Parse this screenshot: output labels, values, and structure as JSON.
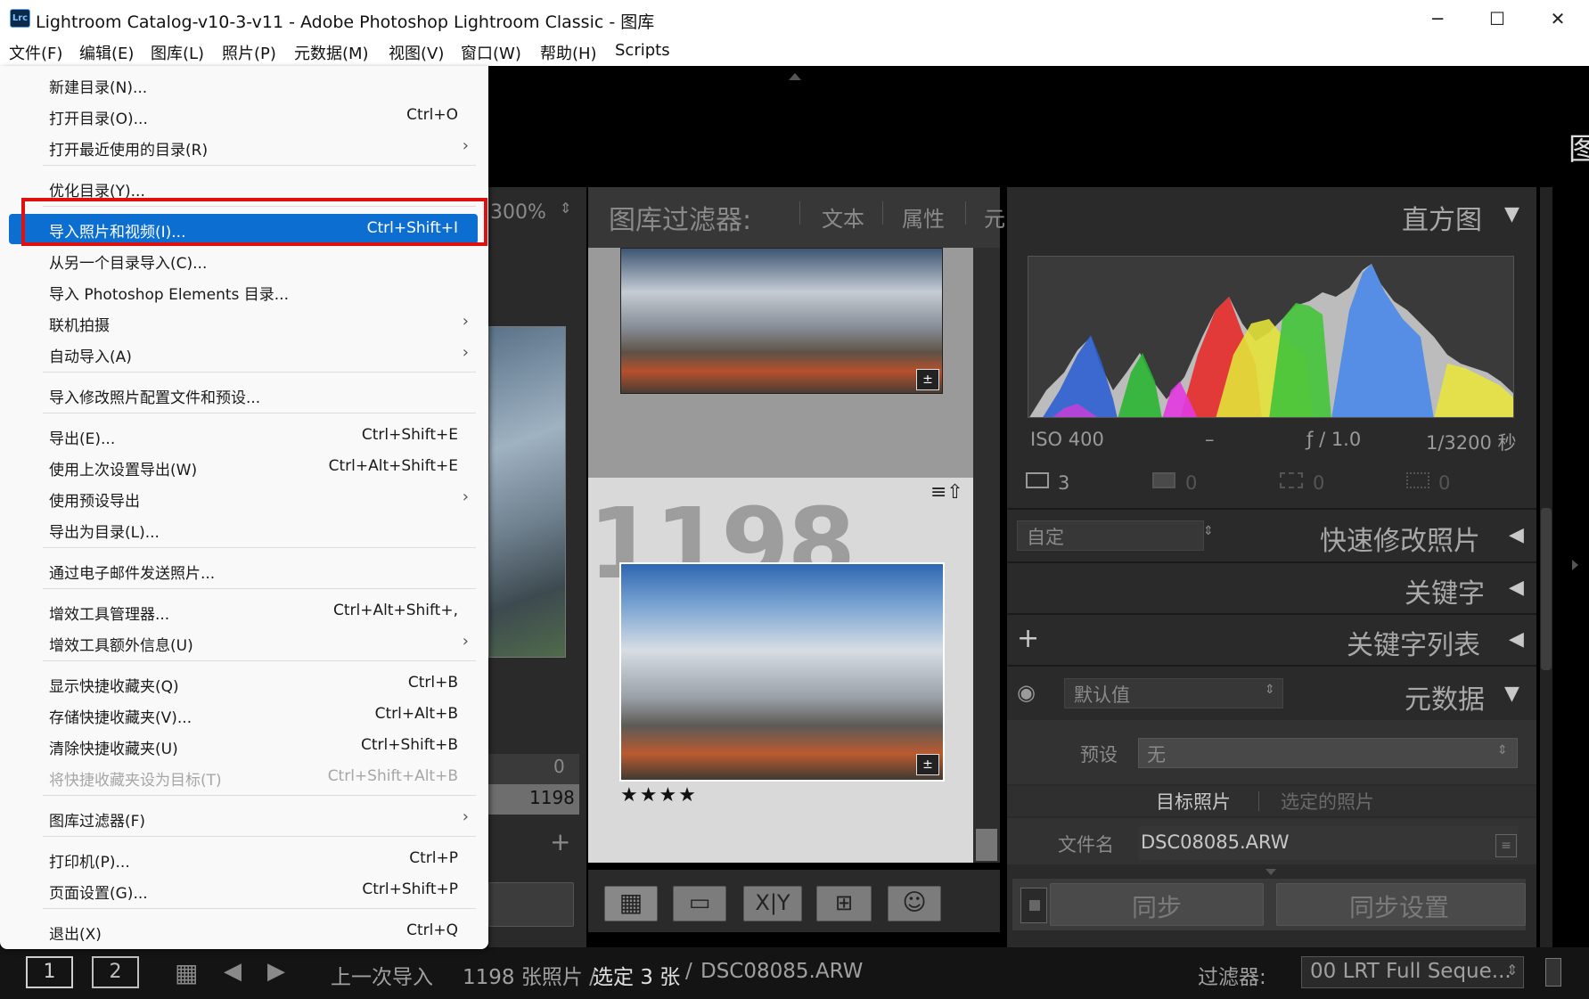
{
  "window": {
    "title": "Lightroom Catalog-v10-3-v11 - Adobe Photoshop Lightroom Classic - 图库",
    "logo": "Lrc",
    "minimize_icon": "─",
    "maximize_icon": "☐",
    "close_icon": "✕"
  },
  "menubar": {
    "items": [
      "文件(F)",
      "编辑(E)",
      "图库(L)",
      "照片(P)",
      "元数据(M)",
      "视图(V)",
      "窗口(W)",
      "帮助(H)",
      "Scripts"
    ]
  },
  "file_menu": {
    "items": [
      {
        "label": "新建目录(N)...",
        "shortcut": ""
      },
      {
        "label": "打开目录(O)...",
        "shortcut": "Ctrl+O"
      },
      {
        "label": "打开最近使用的目录(R)",
        "shortcut": "",
        "submenu": "›"
      },
      {
        "label": "优化目录(Y)...",
        "shortcut": ""
      },
      {
        "label": "导入照片和视频(I)...",
        "shortcut": "Ctrl+Shift+I",
        "highlighted": true
      },
      {
        "label": "从另一个目录导入(C)...",
        "shortcut": ""
      },
      {
        "label": "导入 Photoshop Elements 目录...",
        "shortcut": ""
      },
      {
        "label": "联机拍摄",
        "shortcut": "",
        "submenu": "›"
      },
      {
        "label": "自动导入(A)",
        "shortcut": "",
        "submenu": "›"
      },
      {
        "label": "导入修改照片配置文件和预设...",
        "shortcut": ""
      },
      {
        "label": "导出(E)...",
        "shortcut": "Ctrl+Shift+E"
      },
      {
        "label": "使用上次设置导出(W)",
        "shortcut": "Ctrl+Alt+Shift+E"
      },
      {
        "label": "使用预设导出",
        "shortcut": "",
        "submenu": "›"
      },
      {
        "label": "导出为目录(L)...",
        "shortcut": ""
      },
      {
        "label": "通过电子邮件发送照片...",
        "shortcut": ""
      },
      {
        "label": "增效工具管理器...",
        "shortcut": "Ctrl+Alt+Shift+,"
      },
      {
        "label": "增效工具额外信息(U)",
        "shortcut": "",
        "submenu": "›"
      },
      {
        "label": "显示快捷收藏夹(Q)",
        "shortcut": "Ctrl+B"
      },
      {
        "label": "存储快捷收藏夹(V)...",
        "shortcut": "Ctrl+Alt+B"
      },
      {
        "label": "清除快捷收藏夹(U)",
        "shortcut": "Ctrl+Shift+B"
      },
      {
        "label": "将快捷收藏夹设为目标(T)",
        "shortcut": "Ctrl+Shift+Alt+B",
        "disabled": true
      },
      {
        "label": "图库过滤器(F)",
        "shortcut": "",
        "submenu": "›"
      },
      {
        "label": "打印机(P)...",
        "shortcut": "Ctrl+P"
      },
      {
        "label": "页面设置(G)...",
        "shortcut": "Ctrl+Shift+P"
      },
      {
        "label": "退出(X)",
        "shortcut": "Ctrl+Q"
      }
    ]
  },
  "top_right_char": "图",
  "left_panel": {
    "zoom": "300%",
    "count_zero": "0",
    "count_total": "1198",
    "add_icon": "+"
  },
  "center": {
    "filter_label": "图库过滤器:",
    "filter_tabs": [
      "文本",
      "属性",
      "元"
    ],
    "cell_number": "1198",
    "stars": "★★★★",
    "badge_icon": "≡⇧"
  },
  "right_panel": {
    "histogram_title": "直方图",
    "iso": "ISO 400",
    "dash": "–",
    "aperture": "ƒ / 1.0",
    "shutter": "1/3200 秒",
    "counts": [
      "3",
      "0",
      "0",
      "0"
    ],
    "quick_develop_preset": "自定",
    "quick_develop_title": "快速修改照片",
    "keywords_title": "关键字",
    "keyword_list_title": "关键字列表",
    "keyword_add": "+",
    "metadata_preset": "默认值",
    "metadata_title": "元数据",
    "preset_label": "预设",
    "preset_value": "无",
    "target_photo": "目标照片",
    "selected_photos": "选定的照片",
    "filename_label": "文件名",
    "filename_value": "DSC08085.ARW",
    "sync_btn": "同步",
    "sync_settings_btn": "同步设置"
  },
  "bottom_bar": {
    "page1": "1",
    "page2": "2",
    "source": "上一次导入",
    "info": "1198 张照片 /",
    "selected": "选定 3 张",
    "sep": "/",
    "file": "DSC08085.ARW",
    "filter_label": "过滤器:",
    "filter_value": "00 LRT Full Seque..."
  }
}
